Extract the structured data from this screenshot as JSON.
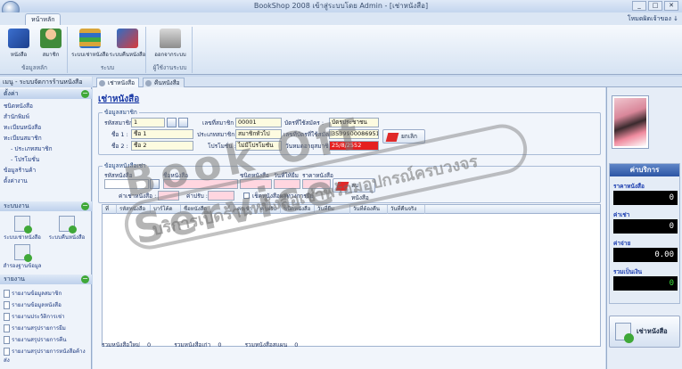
{
  "window": {
    "title": "BookShop 2008 เข้าสู่ระบบโดย Admin - [เช่าหนังสือ]",
    "controls": [
      "_",
      "□",
      "✕"
    ]
  },
  "ribbon": {
    "tab": "หน้าหลัก",
    "login": "โหมดผิดเจ้าของ ↓",
    "groups": [
      {
        "name": "ข้อมูลหลัก",
        "buttons": [
          "หนังสือ",
          "สมาชิก"
        ]
      },
      {
        "name": "ระบบ",
        "buttons": [
          "ระบบเช่าหนังสือ",
          "ระบบคืนหนังสือ"
        ]
      },
      {
        "name": "ผู้ใช้งานระบบ",
        "buttons": [
          "ออกจากระบบ"
        ]
      }
    ]
  },
  "sidebar": {
    "menu_title": "เมนู - ระบบจัดการร้านหนังสือ",
    "sections": {
      "settings": {
        "title": "ตั้งค่า",
        "items": [
          "ชนิดหนังสือ",
          "สำนักพิมพ์",
          "ทะเบียนหนังสือ",
          "ทะเบียนสมาชิก",
          "- ประเภทสมาชิก",
          "- โปรโมชั่น",
          "ข้อมูลร้านค้า",
          "ตั้งค่างาน"
        ]
      },
      "system": {
        "title": "ระบบงาน",
        "items": [
          "ระบบเช่าหนังสือ",
          "ระบบคืนหนังสือ",
          "สำรองฐานข้อมูล"
        ]
      },
      "reports": {
        "title": "รายงาน",
        "items": [
          "รายงานข้อมูลสมาชิก",
          "รายงานข้อมูลหนังสือ",
          "รายงานประวัติการเช่า",
          "รายงานสรุปรายการยืม",
          "รายงานสรุปรายการคืน",
          "รายงานสรุปรายการหนังสือค้างส่ง"
        ]
      }
    }
  },
  "doc_tabs": [
    "เช่าหนังสือ",
    "คืนหนังสือ"
  ],
  "page": {
    "title": "เช่าหนังสือ",
    "member_section": "ข้อมูลสมาชิก",
    "labels": {
      "member_code": "รหัสสมาชิก :",
      "name1": "ชื่อ 1 :",
      "name2": "ชื่อ 2 :",
      "member_no": "เลขที่สมาชิก :",
      "member_type": "ประเภทสมาชิก :",
      "promotion": "โปรโมชั่น :",
      "card_type": "บัตรที่ใช้สมัคร :",
      "card_no": "เลขที่บัตรที่ใช้สมัคร :",
      "expiry": "วันหมดอายุสมาชิก :"
    },
    "values": {
      "member_code": "1",
      "name1": "ชื่อ 1",
      "name2": "ชื่อ 2",
      "member_no": "00001",
      "member_type": "สมาชิกทั่วไป",
      "promotion": "ไม่มีโปรโมชั่น",
      "card_type": "บัตรประชาชน",
      "card_no": "3539900086951",
      "expiry": "25/8/2552"
    },
    "cancel_label": "ยกเลิก",
    "rent_section": "ข้อมูลหนังสือเช่า",
    "rent_labels": {
      "book_code": "รหัสหนังสือ",
      "book_name": "ชื่อหนังสือ",
      "type": "ชนิดหนังสือ",
      "days": "วันที่ให้ยืม",
      "price": "ราคาหนังสือ",
      "rent_fee": "ค่าเช่าหนังสือ :",
      "deposit": "ค่าปรับ :",
      "check": "เช็คหนังสือผลทางการยืม"
    },
    "remove_label": "ลบหนังสือ",
    "grid_headers": [
      "ที่",
      "รหัสหนังสือ",
      "บาร์โค้ด",
      "ชื่อหนังสือ",
      "ค่าเช่า",
      "ค่าปรับ",
      "ชนิดหนังสือ",
      "วันที่ยืม",
      "วันที่ต้องคืน",
      "วันที่คืนจริง"
    ],
    "footer": {
      "new_label": "รวมหนังสือใหม่",
      "new_value": "0",
      "old_label": "รวมหนังสือเก่า",
      "old_value": "0",
      "sum_label": "รวมหนังสือสแผน",
      "sum_value": "0"
    }
  },
  "service": {
    "title": "ค่าบริการ",
    "rows": [
      {
        "label": "ราคาหนังสือ",
        "value": "0",
        "color": "#ffffff"
      },
      {
        "label": "ค่าเช่า",
        "value": "0",
        "color": "#ffffff"
      },
      {
        "label": "ค่าจ่าย",
        "value": "0.00",
        "color": "#ffffff"
      },
      {
        "label": "รวมเป็นเงิน",
        "value": "0",
        "color": "#3fe23f"
      }
    ],
    "rent_button": "เช่าหนังสือ"
  },
  "watermark": {
    "big": "Book Off Service",
    "small": "บริการเปิดร้านหนังสือเช่าพร้อมอุปกรณ์ครบวงจร"
  }
}
